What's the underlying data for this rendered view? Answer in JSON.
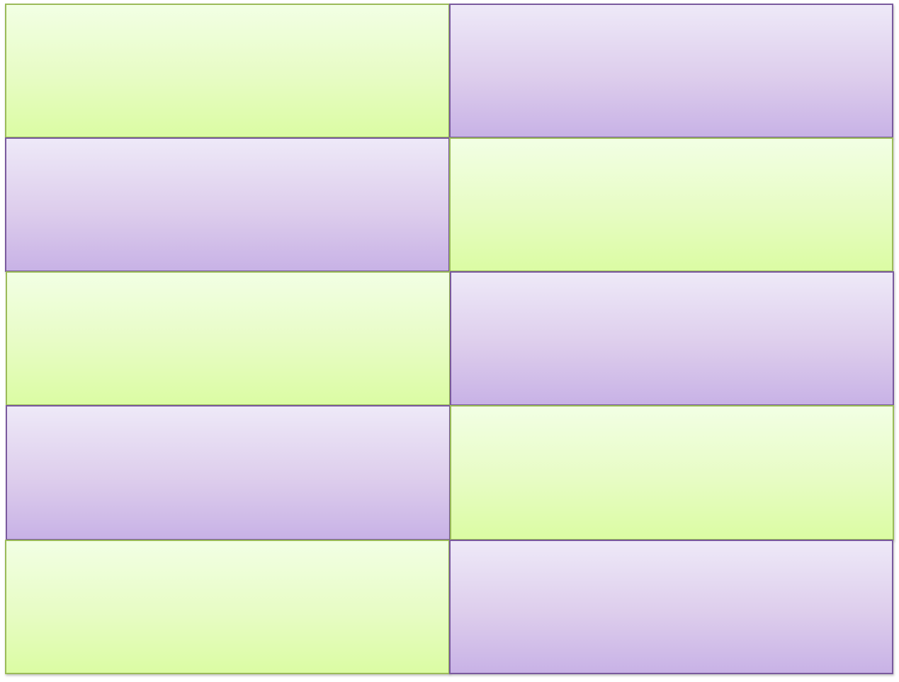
{
  "colors": {
    "green_fill_top": "#f2ffe4",
    "green_fill_bottom": "#dbfca3",
    "green_border": "#9bbb59",
    "purple_fill_top": "#eee9f8",
    "purple_fill_bottom": "#c8b2e6",
    "purple_border": "#7a5a9e"
  },
  "grid": {
    "rows": [
      {
        "left": "green",
        "right": "purple"
      },
      {
        "left": "purple",
        "right": "green"
      },
      {
        "left": "green",
        "right": "purple"
      },
      {
        "left": "purple",
        "right": "green"
      },
      {
        "left": "green",
        "right": "purple"
      }
    ]
  }
}
